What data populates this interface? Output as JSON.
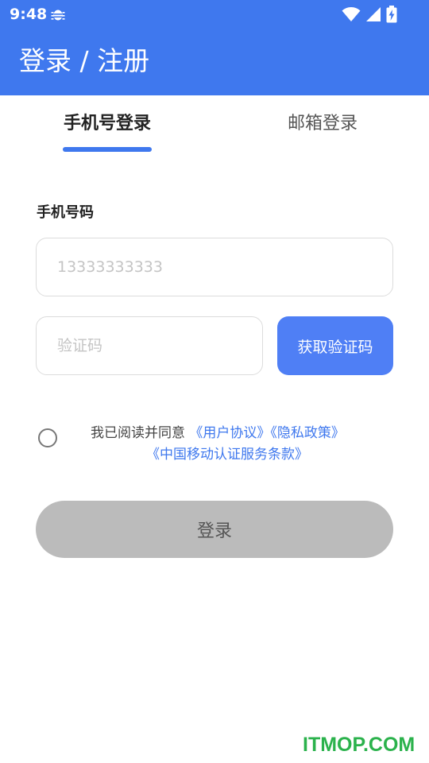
{
  "status_bar": {
    "time": "9:48",
    "icons": [
      "bug-icon",
      "wifi-icon",
      "signal-icon",
      "battery-charging-icon"
    ]
  },
  "app_bar": {
    "title": "登录 / 注册",
    "background": "#3f78ee"
  },
  "tabs": [
    {
      "label": "手机号登录",
      "active": true
    },
    {
      "label": "邮箱登录",
      "active": false
    }
  ],
  "form": {
    "phone_label": "手机号码",
    "phone_placeholder": "13333333333",
    "code_placeholder": "验证码",
    "get_code_label": "获取验证码",
    "get_code_color": "#4f7ff5"
  },
  "agreement": {
    "checked": false,
    "prefix": "我已阅读并同意",
    "user_agreement": "《用户协议》",
    "privacy_policy": "《隐私政策》",
    "cmcc_terms": "《中国移动认证服务条款》",
    "link_color": "#3f78ee"
  },
  "login_button": {
    "label": "登录",
    "background": "#bbbbbb"
  },
  "watermark": "ITMOP.COM"
}
